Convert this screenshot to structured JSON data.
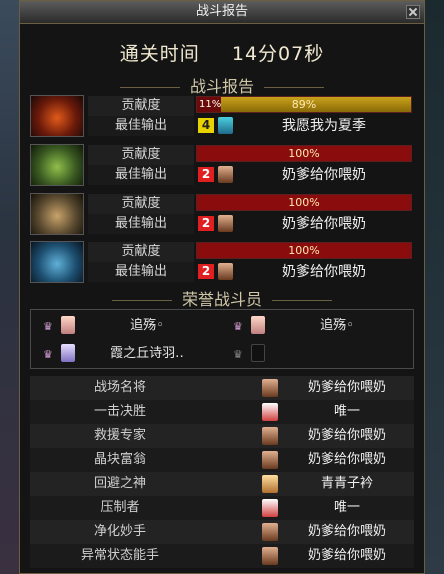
{
  "window": {
    "title": "战斗报告"
  },
  "clear_time": {
    "label": "通关时间",
    "value": "14分07秒"
  },
  "sections": {
    "report": "战斗报告",
    "honor": "荣誉战斗员"
  },
  "row_labels": {
    "contribution": "贡献度",
    "best_output": "最佳输出"
  },
  "players": [
    {
      "class_icon": "fire-class-portrait",
      "self_percent": "11%",
      "team_percent": "89%",
      "fill_fraction": 0.89,
      "bar_color": "#a8860f",
      "best_rank": "4",
      "rank_color": "#e8d200",
      "best_name": "我愿我为夏季"
    },
    {
      "class_icon": "poison-class-portrait",
      "self_percent": "",
      "team_percent": "100%",
      "fill_fraction": 1.0,
      "bar_color": "#8a0c0c",
      "best_rank": "2",
      "rank_color": "#e02020",
      "best_name": "奶爹给你喂奶"
    },
    {
      "class_icon": "earth-class-portrait",
      "self_percent": "",
      "team_percent": "100%",
      "fill_fraction": 1.0,
      "bar_color": "#8a0c0c",
      "best_rank": "2",
      "rank_color": "#e02020",
      "best_name": "奶爹给你喂奶"
    },
    {
      "class_icon": "ice-class-portrait",
      "self_percent": "",
      "team_percent": "100%",
      "fill_fraction": 1.0,
      "bar_color": "#8a0c0c",
      "best_rank": "2",
      "rank_color": "#e02020",
      "best_name": "奶爹给你喂奶"
    }
  ],
  "honor": [
    {
      "name": "追殇◦",
      "empty": false
    },
    {
      "name": "追殇◦",
      "empty": false
    },
    {
      "name": "霞之丘诗羽‥",
      "empty": false
    },
    {
      "name": "",
      "empty": true
    }
  ],
  "titles": [
    {
      "title": "战场名将",
      "player": "奶爹给你喂奶"
    },
    {
      "title": "一击决胜",
      "player": "唯一"
    },
    {
      "title": "救援专家",
      "player": "奶爹给你喂奶"
    },
    {
      "title": "晶块富翁",
      "player": "奶爹给你喂奶"
    },
    {
      "title": "回避之神",
      "player": "青青子衿"
    },
    {
      "title": "压制者",
      "player": "唯一"
    },
    {
      "title": "净化妙手",
      "player": "奶爹给你喂奶"
    },
    {
      "title": "异常状态能手",
      "player": "奶爹给你喂奶"
    }
  ],
  "colors": {
    "accent_gold": "#cfc6a8",
    "bar_red": "#8a0c0c",
    "bar_gold": "#a8860f"
  }
}
